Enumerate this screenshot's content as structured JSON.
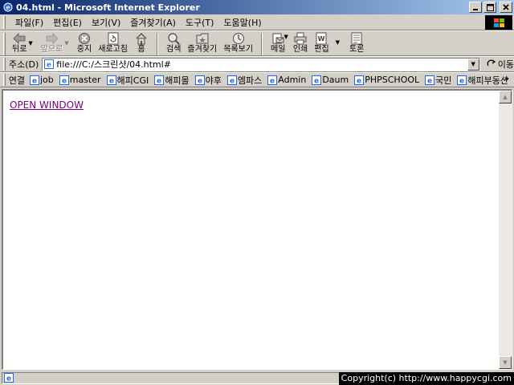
{
  "window": {
    "title": "04.html - Microsoft Internet Explorer"
  },
  "menu": {
    "items": [
      "파일(F)",
      "편집(E)",
      "보기(V)",
      "즐겨찾기(A)",
      "도구(T)",
      "도움말(H)"
    ]
  },
  "toolbar": {
    "back": "뒤로",
    "forward": "앞으로",
    "stop": "중지",
    "refresh": "새로고침",
    "home": "홈",
    "search": "검색",
    "favorites": "즐겨찾기",
    "history": "목록보기",
    "mail": "메일",
    "print": "인쇄",
    "edit": "편집",
    "discuss": "토론"
  },
  "address": {
    "label": "주소(D)",
    "value": "file:///C:/스크린샷/04.html#",
    "go_label": "이동"
  },
  "links": {
    "label": "연결",
    "items": [
      "job",
      "master",
      "해피CGI",
      "해피몰",
      "야후",
      "엠파스",
      "Admin",
      "Daum",
      "PHPSCHOOL",
      "국민",
      "해피부동산"
    ],
    "more": "»"
  },
  "content": {
    "link_text": "OPEN WINDOW",
    "link_color": "#800080"
  },
  "status": {
    "copyright": "Copyright(c) http://www.happycgi.com"
  },
  "colors": {
    "titlebar_start": "#0a246a",
    "titlebar_end": "#a6caf0",
    "chrome": "#d4d0c8"
  }
}
